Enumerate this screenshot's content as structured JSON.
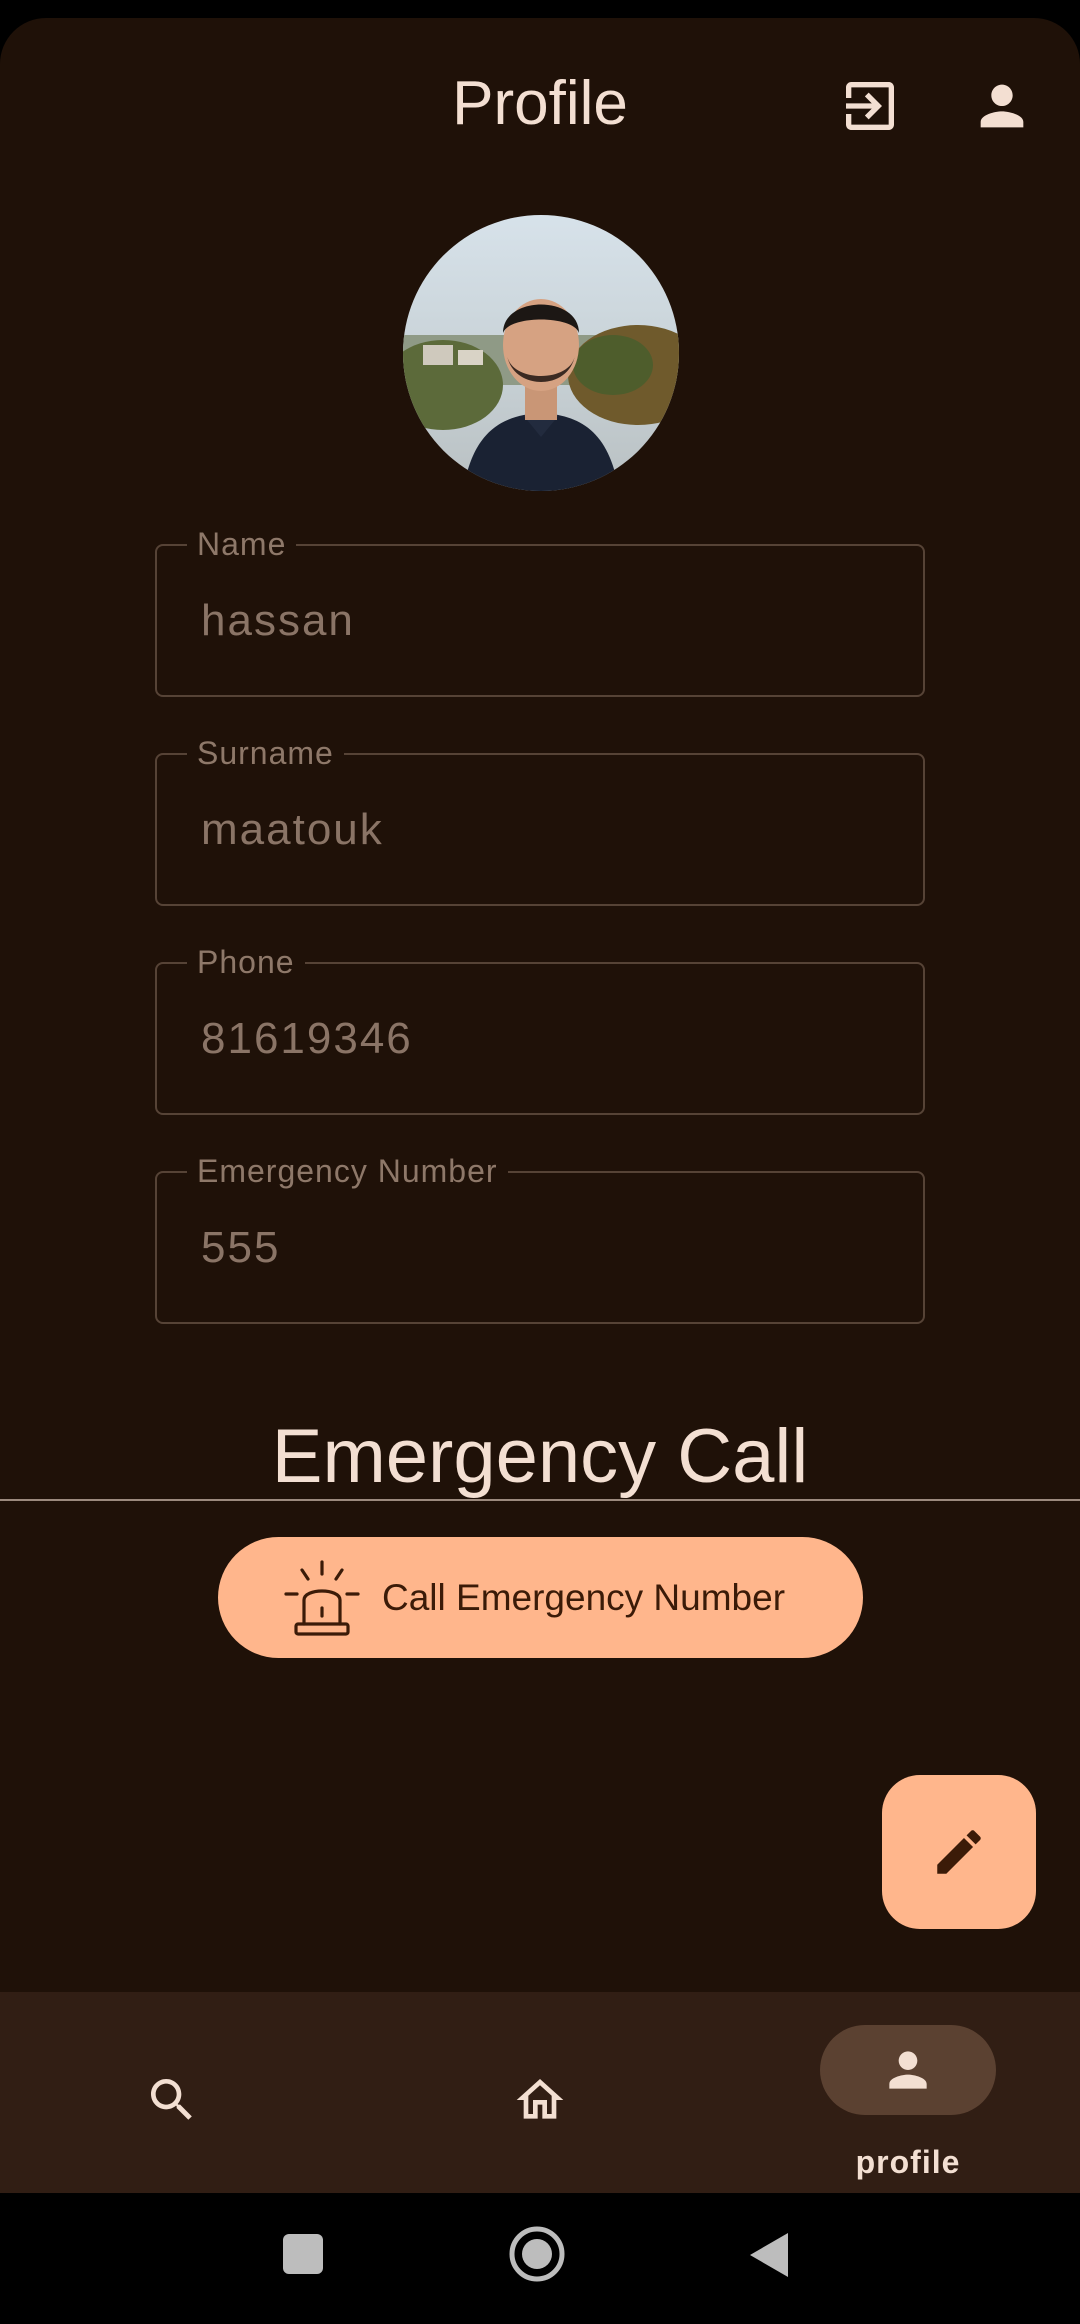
{
  "header": {
    "title": "Profile",
    "logout_icon": "logout-icon",
    "account_icon": "account-icon"
  },
  "avatar": {
    "description_icon": "profile-photo"
  },
  "fields": [
    {
      "label": "Name",
      "value": "hassan"
    },
    {
      "label": "Surname",
      "value": "maatouk"
    },
    {
      "label": "Phone",
      "value": "81619346"
    },
    {
      "label": "Emergency Number",
      "value": "555"
    }
  ],
  "emergency": {
    "title": "Emergency Call",
    "button_label": "Call Emergency Number",
    "button_icon": "siren-icon"
  },
  "fab": {
    "icon": "edit-pencil-icon"
  },
  "bottom_nav": {
    "items": [
      {
        "icon": "search-icon",
        "label": ""
      },
      {
        "icon": "home-icon",
        "label": ""
      },
      {
        "icon": "profile-icon",
        "label": "profile",
        "selected": true
      }
    ]
  },
  "system_nav": {
    "icons": [
      "recents-icon",
      "home-circle-icon",
      "back-icon"
    ]
  },
  "colors": {
    "background": "#1f1108",
    "accent": "#ffb68c",
    "text_primary": "#f3dfd2",
    "nav_background": "#311e14",
    "nav_selected_pill": "#5b4131"
  }
}
